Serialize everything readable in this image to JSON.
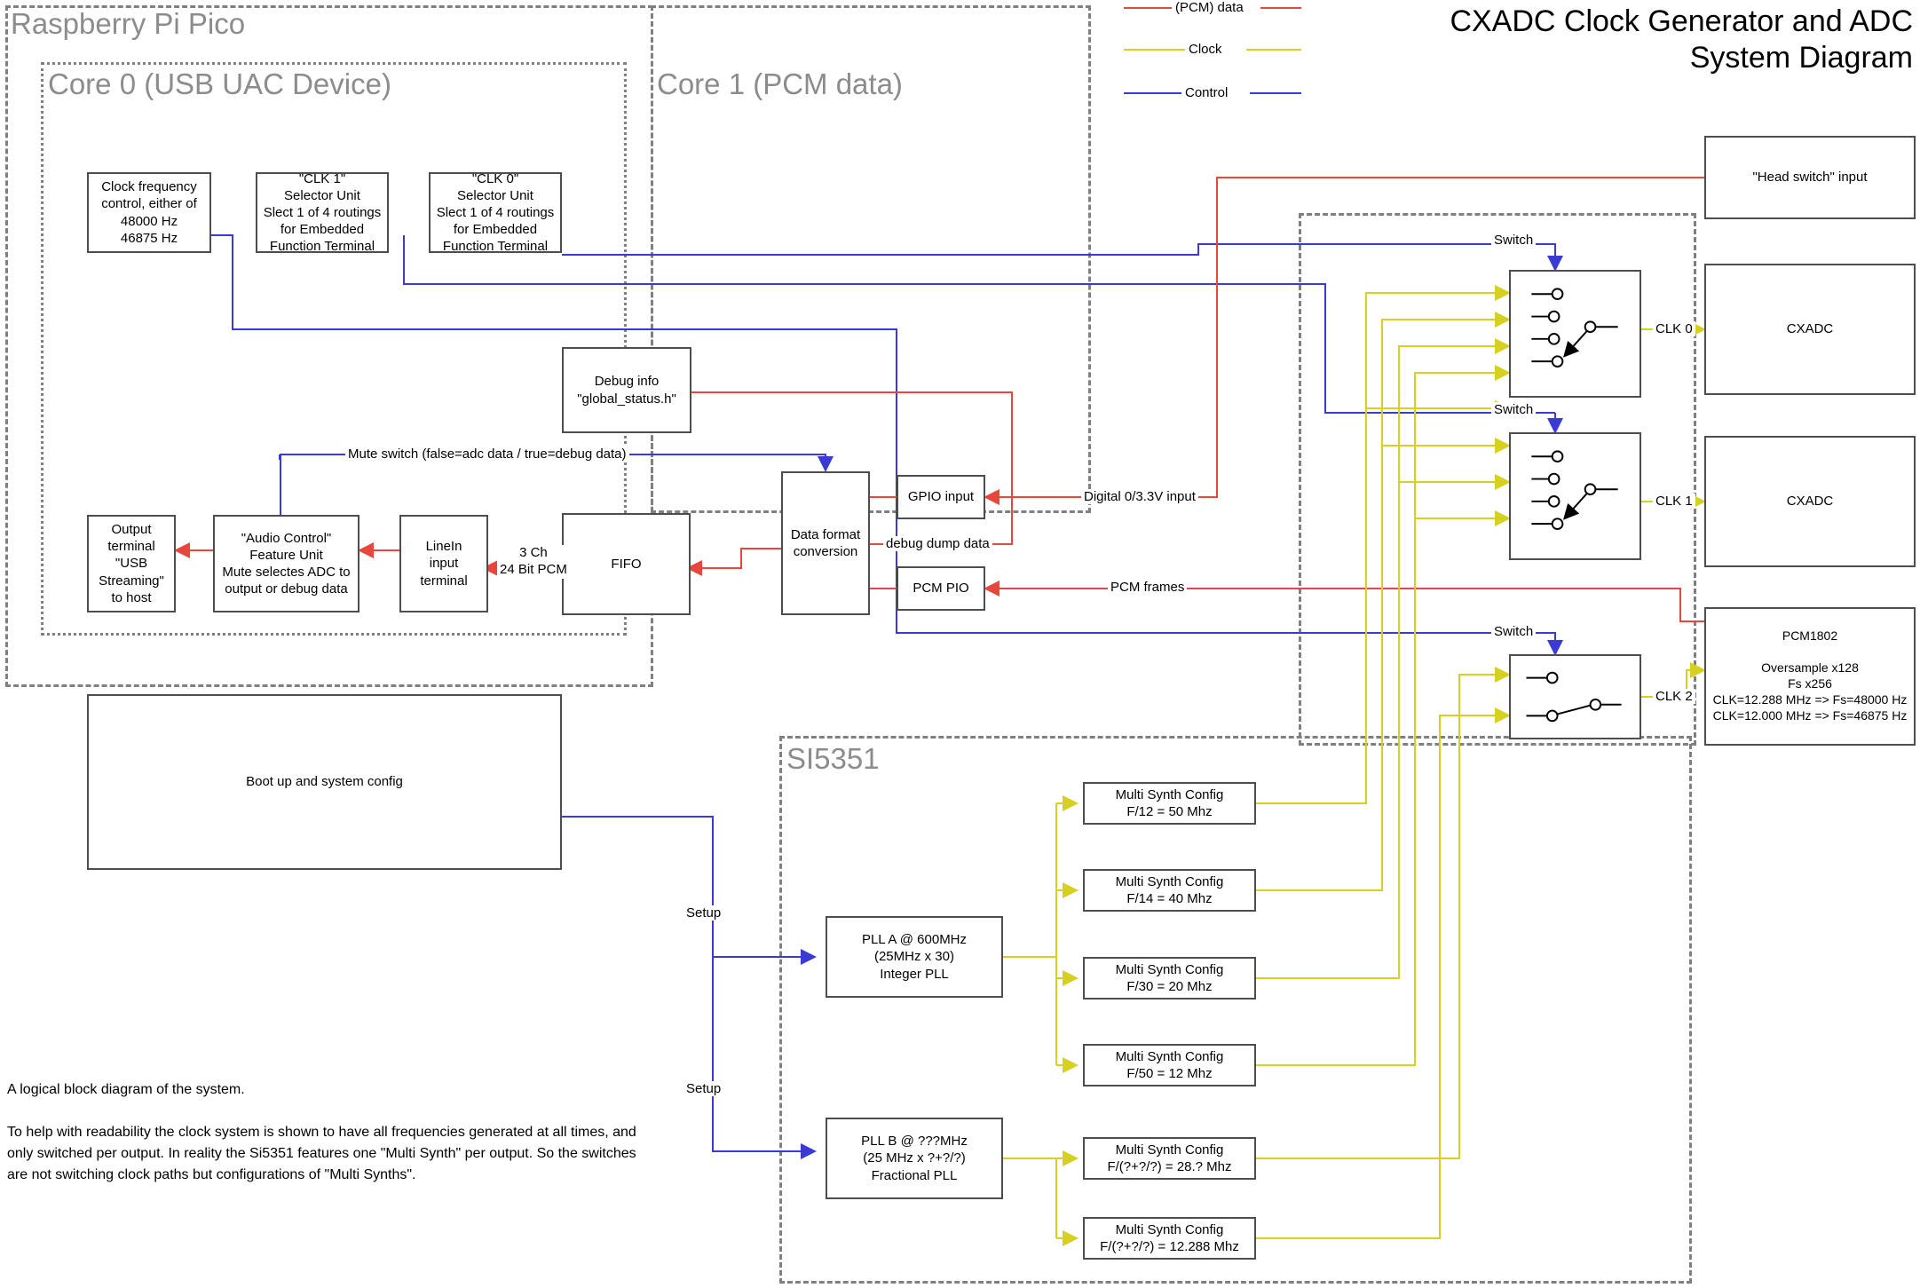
{
  "title": "CXADC Clock Generator and ADC\nSystem Diagram",
  "legend": [
    {
      "label": "(PCM) data",
      "color": "#e8453c"
    },
    {
      "label": "Clock",
      "color": "#d6d020"
    },
    {
      "label": "Control",
      "color": "#3b3bd4"
    }
  ],
  "colors": {
    "data": "#e8453c",
    "clock": "#d6d020",
    "control": "#3b3bd4",
    "box_border": "#4d4d4d",
    "group_border": "#808080",
    "group_title": "#8c8c8c"
  },
  "groups": {
    "pico": "Raspberry Pi Pico",
    "core0": "Core 0 (USB UAC Device)",
    "core1": "Core 1 (PCM data)",
    "si5351": "SI5351"
  },
  "boxes": {
    "clock_freq_control": "Clock frequency\ncontrol, either of\n48000 Hz\n46875 Hz",
    "clk1_selector": "\"CLK 1\"\nSelector Unit\nSlect 1 of 4 routings\nfor Embedded\nFunction Terminal",
    "clk0_selector": "\"CLK 0\"\nSelector Unit\nSlect 1 of 4 routings\nfor Embedded\nFunction Terminal",
    "debug_info": "Debug info\n\"global_status.h\"",
    "output_terminal": "Output\nterminal\n\"USB\nStreaming\"\nto host",
    "audio_control": "\"Audio Control\"\nFeature Unit\nMute selectes ADC to\noutput or debug data",
    "linein": "LineIn\ninput terminal",
    "fifo": "FIFO",
    "data_format": "Data format\nconversion",
    "gpio_input": "GPIO input",
    "pcm_pio": "PCM PIO",
    "bootup": "Boot up and system config",
    "head_switch": "\"Head switch\" input",
    "cxadc0": "CXADC",
    "cxadc1": "CXADC",
    "pcm1802": "PCM1802\n\nOversample x128\nFs x256\nCLK=12.288 MHz => Fs=48000 Hz\nCLK=12.000 MHz => Fs=46875 Hz",
    "pll_a": "PLL A @ 600MHz\n(25MHz x 30)\nInteger PLL",
    "pll_b": "PLL B @ ???MHz\n(25 MHz x ?+?/?)\nFractional PLL",
    "ms_f12": "Multi Synth Config\nF/12 = 50 Mhz",
    "ms_f14": "Multi Synth Config\nF/14 = 40 Mhz",
    "ms_f30": "Multi Synth Config\nF/30 = 20 Mhz",
    "ms_f50": "Multi Synth Config\nF/50 = 12 Mhz",
    "ms_fb1": "Multi Synth Config\nF/(?+?/?) = 28.? Mhz",
    "ms_fb2": "Multi Synth Config\nF/(?+?/?) = 12.288 Mhz"
  },
  "wire_labels": {
    "mute_switch": "Mute switch (false=adc data / true=debug data)",
    "three_ch": "3 Ch\n24 Bit PCM",
    "debug_dump": "debug dump data",
    "digital_input": "Digital 0/3.3V input",
    "pcm_frames": "PCM frames",
    "switch0": "Switch",
    "switch1": "Switch",
    "switch2": "Switch",
    "clk0": "CLK 0",
    "clk1": "CLK 1",
    "clk2": "CLK 2",
    "setup_a": "Setup",
    "setup_b": "Setup"
  },
  "note": "A logical block diagram of the system.\n\nTo help with readability the clock system is shown to have all frequencies generated at all times, and only switched per output. In reality the Si5351 features one \"Multi Synth\" per output. So the switches are not switching clock paths but configurations of \"Multi Synths\"."
}
